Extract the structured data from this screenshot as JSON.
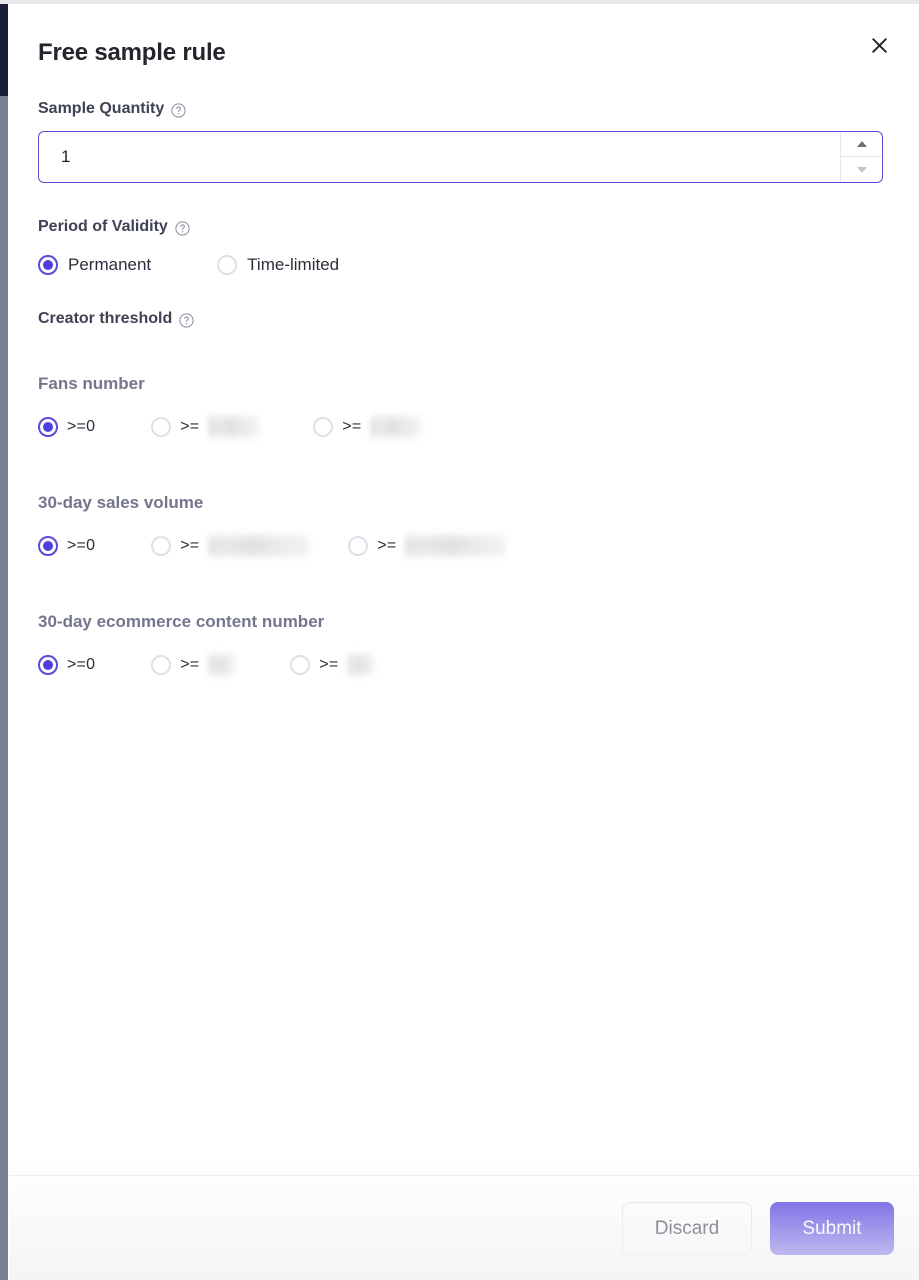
{
  "modal": {
    "title": "Free sample rule",
    "close_icon": "close-icon"
  },
  "sample_quantity": {
    "label": "Sample Quantity",
    "help_icon": "help-circle-icon",
    "value": "1",
    "placeholder": "",
    "spinner_up_icon": "chevron-up-icon",
    "spinner_down_icon": "chevron-down-icon"
  },
  "period_of_validity": {
    "label": "Period of Validity",
    "help_icon": "help-circle-icon",
    "options": [
      {
        "label": "Permanent",
        "checked": true
      },
      {
        "label": "Time-limited",
        "checked": false
      }
    ]
  },
  "creator_threshold": {
    "label": "Creator threshold",
    "help_icon": "help-circle-icon",
    "groups": [
      {
        "label": "Fans number",
        "options": [
          {
            "operator": ">=0",
            "redacted": false,
            "checked": true
          },
          {
            "operator": ">=",
            "redacted": true,
            "checked": false
          },
          {
            "operator": ">=",
            "redacted": true,
            "checked": false
          }
        ]
      },
      {
        "label": "30-day sales volume",
        "options": [
          {
            "operator": ">=0",
            "redacted": false,
            "checked": true
          },
          {
            "operator": ">=",
            "redacted": true,
            "checked": false
          },
          {
            "operator": ">=",
            "redacted": true,
            "checked": false
          }
        ]
      },
      {
        "label": "30-day ecommerce content number",
        "options": [
          {
            "operator": ">=0",
            "redacted": false,
            "checked": true
          },
          {
            "operator": ">=",
            "redacted": true,
            "checked": false
          },
          {
            "operator": ">=",
            "redacted": true,
            "checked": false
          }
        ]
      }
    ]
  },
  "footer": {
    "discard_label": "Discard",
    "submit_label": "Submit"
  },
  "colors": {
    "accent": "#4f3fe0",
    "accent_border": "#5b4bdb",
    "title_text": "#25262d",
    "label_text": "#3f4254",
    "sub_label_text": "#73768c",
    "body_text": "#2c2d3a",
    "divider": "#ececf0",
    "rail_dark": "#1b1c38",
    "rail_gray": "#7c8094"
  }
}
